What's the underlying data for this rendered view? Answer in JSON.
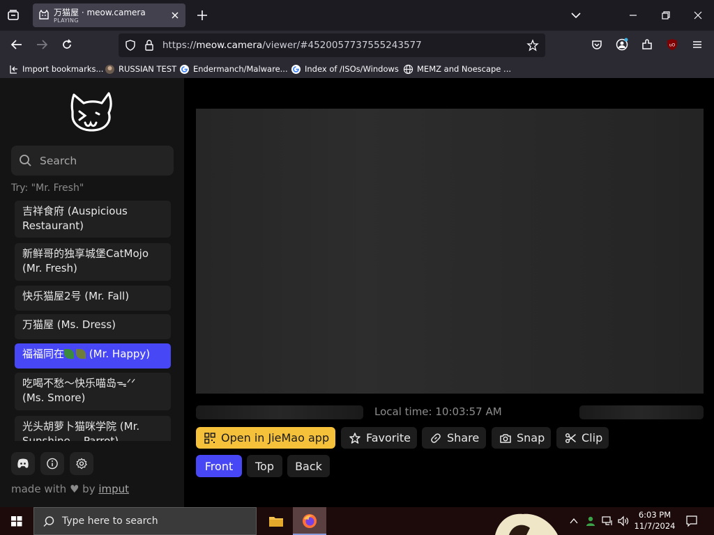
{
  "browser": {
    "tab": {
      "title": "万猫屋 · meow.camera",
      "status": "PLAYING"
    },
    "url": {
      "prefix": "https://",
      "host": "meow.camera",
      "path": "/viewer/#4520057737555243577"
    },
    "bookmarks": [
      {
        "label": "Import bookmarks...",
        "icon": "import-icon"
      },
      {
        "label": "RUSSIAN TEST",
        "icon": "site-favicon"
      },
      {
        "label": "Endermanch/Malware...",
        "icon": "google-icon"
      },
      {
        "label": "Index of /ISOs/Windows",
        "icon": "google-icon"
      },
      {
        "label": "MEMZ and Noescape ...",
        "icon": "globe-icon"
      }
    ]
  },
  "sidebar": {
    "search_placeholder": "Search",
    "try_hint": "Try: \"Mr. Fresh\"",
    "feeders": [
      {
        "line1": "吉祥食府 (Auspicious",
        "line2": "Restaurant)"
      },
      {
        "line1": "新鲜哥的独享城堡CatMojo",
        "line2": "(Mr. Fresh)"
      },
      {
        "line1": "快乐猫屋2号 (Mr. Fall)",
        "line2": ""
      },
      {
        "line1": "万猫屋 (Ms. Dress)",
        "line2": ""
      },
      {
        "line1_a": "福福同在",
        "line1_b": "(Mr. Happy)",
        "active": true
      },
      {
        "line1": "吃喝不愁～快乐喵岛ᯓᐟᐟ",
        "line2": "(Ms. Smore)"
      },
      {
        "line1": "光头胡萝卜猫咪学院 (Mr.",
        "line2": "Sunshine... Parrot)"
      }
    ],
    "footer": {
      "made_with": "made with",
      "by": "by",
      "imput": "imput"
    }
  },
  "viewer": {
    "local_time": "Local time: 10:03:57 AM",
    "actions": {
      "open_app": "Open in JieMao app",
      "favorite": "Favorite",
      "share": "Share",
      "snap": "Snap",
      "clip": "Clip"
    },
    "cameras": {
      "front": "Front",
      "top": "Top",
      "back": "Back",
      "selected": "Front"
    }
  },
  "taskbar": {
    "search_placeholder": "Type here to search",
    "time": "6:03 PM",
    "date": "11/7/2024"
  },
  "colors": {
    "accent": "#4747f5",
    "app_button": "#f5c13a",
    "sidebar_bg": "#141414"
  }
}
